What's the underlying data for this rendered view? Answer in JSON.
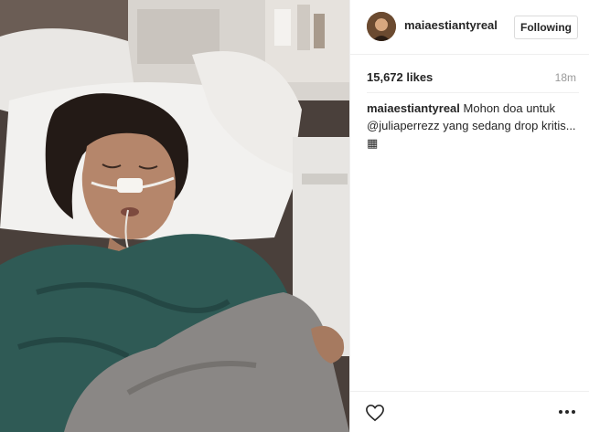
{
  "header": {
    "username": "maiaestiantyreal",
    "follow_label": "Following"
  },
  "stats": {
    "likes": "15,672 likes",
    "time": "18m"
  },
  "caption": {
    "username": "maiaestiantyreal",
    "text_part1": "Mohon doa untuk",
    "mention": "@juliaperrezz",
    "text_part2": "yang sedang drop kritis...",
    "emoji": "▦"
  },
  "icons": {
    "like": "heart-icon",
    "more": "more-options-icon"
  },
  "colors": {
    "text": "#262626",
    "muted": "#999999",
    "border": "#dbdbdb"
  }
}
